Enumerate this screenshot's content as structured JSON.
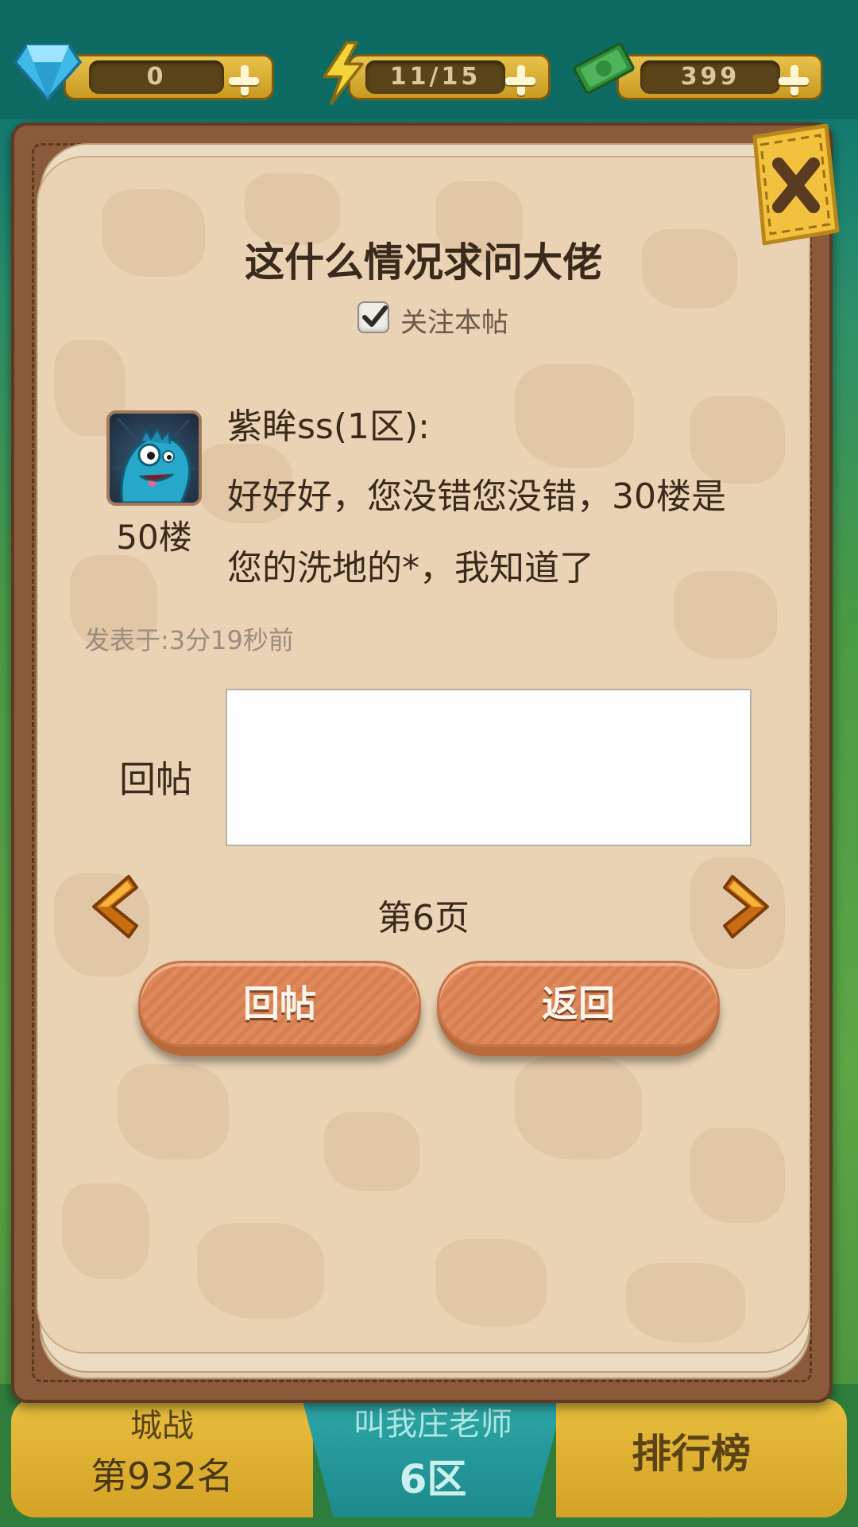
{
  "resources": {
    "gems": "0",
    "energy": "11/15",
    "cash": "399"
  },
  "background_bottom": {
    "left_top": "城战",
    "left_rank": "第932名",
    "mid_top": "叫我庄老师",
    "mid_zone": "6区",
    "right_label": "排行榜"
  },
  "dialog": {
    "title": "这什么情况求问大佬",
    "follow_label": "关注本帖",
    "follow_checked": true
  },
  "post": {
    "floor": "50楼",
    "author": "紫眸ss(1区):",
    "text_line1": "好好好，您没错您没错，30楼是",
    "text_line2": "您的洗地的*，我知道了",
    "posted_at": "发表于:3分19秒前"
  },
  "reply": {
    "label": "回帖",
    "value": "",
    "placeholder": ""
  },
  "pager": {
    "page_label": "第6页"
  },
  "buttons": {
    "reply": "回帖",
    "back": "返回"
  },
  "colors": {
    "page_bg": "#ead3b5",
    "frame": "#8a5a3a",
    "button": "#e08a5c",
    "accent_yellow": "#e9bf3f"
  }
}
